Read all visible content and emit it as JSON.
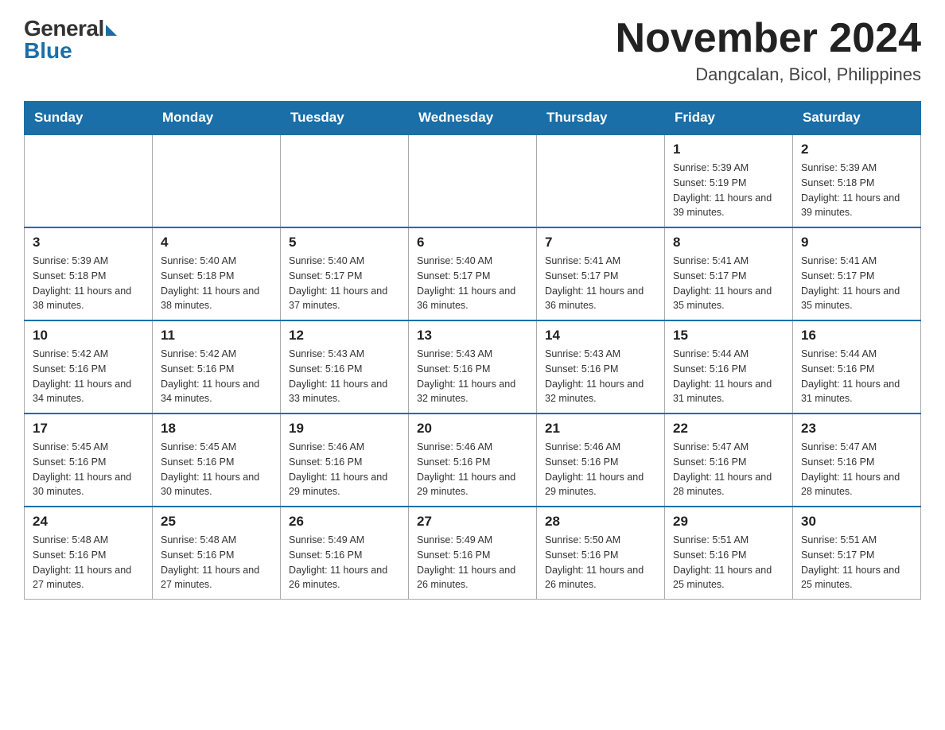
{
  "header": {
    "logo_general": "General",
    "logo_blue": "Blue",
    "month_title": "November 2024",
    "location": "Dangcalan, Bicol, Philippines"
  },
  "calendar": {
    "days_of_week": [
      "Sunday",
      "Monday",
      "Tuesday",
      "Wednesday",
      "Thursday",
      "Friday",
      "Saturday"
    ],
    "weeks": [
      [
        {
          "day": "",
          "info": ""
        },
        {
          "day": "",
          "info": ""
        },
        {
          "day": "",
          "info": ""
        },
        {
          "day": "",
          "info": ""
        },
        {
          "day": "",
          "info": ""
        },
        {
          "day": "1",
          "info": "Sunrise: 5:39 AM\nSunset: 5:19 PM\nDaylight: 11 hours and 39 minutes."
        },
        {
          "day": "2",
          "info": "Sunrise: 5:39 AM\nSunset: 5:18 PM\nDaylight: 11 hours and 39 minutes."
        }
      ],
      [
        {
          "day": "3",
          "info": "Sunrise: 5:39 AM\nSunset: 5:18 PM\nDaylight: 11 hours and 38 minutes."
        },
        {
          "day": "4",
          "info": "Sunrise: 5:40 AM\nSunset: 5:18 PM\nDaylight: 11 hours and 38 minutes."
        },
        {
          "day": "5",
          "info": "Sunrise: 5:40 AM\nSunset: 5:17 PM\nDaylight: 11 hours and 37 minutes."
        },
        {
          "day": "6",
          "info": "Sunrise: 5:40 AM\nSunset: 5:17 PM\nDaylight: 11 hours and 36 minutes."
        },
        {
          "day": "7",
          "info": "Sunrise: 5:41 AM\nSunset: 5:17 PM\nDaylight: 11 hours and 36 minutes."
        },
        {
          "day": "8",
          "info": "Sunrise: 5:41 AM\nSunset: 5:17 PM\nDaylight: 11 hours and 35 minutes."
        },
        {
          "day": "9",
          "info": "Sunrise: 5:41 AM\nSunset: 5:17 PM\nDaylight: 11 hours and 35 minutes."
        }
      ],
      [
        {
          "day": "10",
          "info": "Sunrise: 5:42 AM\nSunset: 5:16 PM\nDaylight: 11 hours and 34 minutes."
        },
        {
          "day": "11",
          "info": "Sunrise: 5:42 AM\nSunset: 5:16 PM\nDaylight: 11 hours and 34 minutes."
        },
        {
          "day": "12",
          "info": "Sunrise: 5:43 AM\nSunset: 5:16 PM\nDaylight: 11 hours and 33 minutes."
        },
        {
          "day": "13",
          "info": "Sunrise: 5:43 AM\nSunset: 5:16 PM\nDaylight: 11 hours and 32 minutes."
        },
        {
          "day": "14",
          "info": "Sunrise: 5:43 AM\nSunset: 5:16 PM\nDaylight: 11 hours and 32 minutes."
        },
        {
          "day": "15",
          "info": "Sunrise: 5:44 AM\nSunset: 5:16 PM\nDaylight: 11 hours and 31 minutes."
        },
        {
          "day": "16",
          "info": "Sunrise: 5:44 AM\nSunset: 5:16 PM\nDaylight: 11 hours and 31 minutes."
        }
      ],
      [
        {
          "day": "17",
          "info": "Sunrise: 5:45 AM\nSunset: 5:16 PM\nDaylight: 11 hours and 30 minutes."
        },
        {
          "day": "18",
          "info": "Sunrise: 5:45 AM\nSunset: 5:16 PM\nDaylight: 11 hours and 30 minutes."
        },
        {
          "day": "19",
          "info": "Sunrise: 5:46 AM\nSunset: 5:16 PM\nDaylight: 11 hours and 29 minutes."
        },
        {
          "day": "20",
          "info": "Sunrise: 5:46 AM\nSunset: 5:16 PM\nDaylight: 11 hours and 29 minutes."
        },
        {
          "day": "21",
          "info": "Sunrise: 5:46 AM\nSunset: 5:16 PM\nDaylight: 11 hours and 29 minutes."
        },
        {
          "day": "22",
          "info": "Sunrise: 5:47 AM\nSunset: 5:16 PM\nDaylight: 11 hours and 28 minutes."
        },
        {
          "day": "23",
          "info": "Sunrise: 5:47 AM\nSunset: 5:16 PM\nDaylight: 11 hours and 28 minutes."
        }
      ],
      [
        {
          "day": "24",
          "info": "Sunrise: 5:48 AM\nSunset: 5:16 PM\nDaylight: 11 hours and 27 minutes."
        },
        {
          "day": "25",
          "info": "Sunrise: 5:48 AM\nSunset: 5:16 PM\nDaylight: 11 hours and 27 minutes."
        },
        {
          "day": "26",
          "info": "Sunrise: 5:49 AM\nSunset: 5:16 PM\nDaylight: 11 hours and 26 minutes."
        },
        {
          "day": "27",
          "info": "Sunrise: 5:49 AM\nSunset: 5:16 PM\nDaylight: 11 hours and 26 minutes."
        },
        {
          "day": "28",
          "info": "Sunrise: 5:50 AM\nSunset: 5:16 PM\nDaylight: 11 hours and 26 minutes."
        },
        {
          "day": "29",
          "info": "Sunrise: 5:51 AM\nSunset: 5:16 PM\nDaylight: 11 hours and 25 minutes."
        },
        {
          "day": "30",
          "info": "Sunrise: 5:51 AM\nSunset: 5:17 PM\nDaylight: 11 hours and 25 minutes."
        }
      ]
    ]
  }
}
